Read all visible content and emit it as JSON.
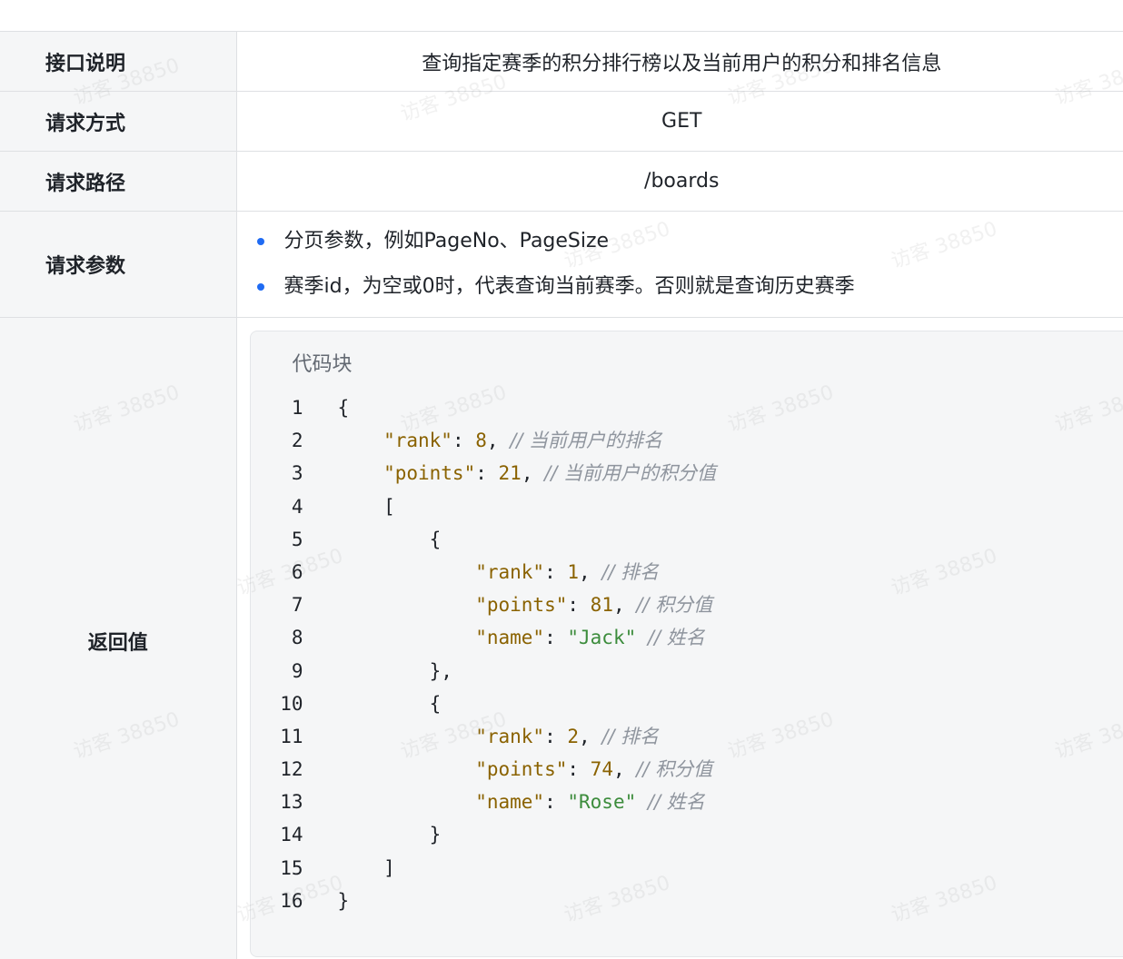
{
  "table": {
    "rows": [
      {
        "label": "接口说明",
        "value": "查询指定赛季的积分排行榜以及当前用户的积分和排名信息"
      },
      {
        "label": "请求方式",
        "value": "GET"
      },
      {
        "label": "请求路径",
        "value": "/boards"
      },
      {
        "label": "请求参数",
        "items": [
          "分页参数，例如PageNo、PageSize",
          "赛季id，为空或0时，代表查询当前赛季。否则就是查询历史赛季"
        ]
      },
      {
        "label": "返回值"
      }
    ]
  },
  "code": {
    "title": "代码块",
    "line_numbers": [
      "1",
      "2",
      "3",
      "4",
      "5",
      "6",
      "7",
      "8",
      "9",
      "10",
      "11",
      "12",
      "13",
      "14",
      "15",
      "16"
    ],
    "l1": "{",
    "l2_key": "\"rank\"",
    "l2_num": "8",
    "l2_comment": "// 当前用户的排名",
    "l3_key": "\"points\"",
    "l3_num": "21",
    "l3_comment": "// 当前用户的积分值",
    "l4": "[",
    "l5": "{",
    "l6_key": "\"rank\"",
    "l6_num": "1",
    "l6_comment": "// 排名",
    "l7_key": "\"points\"",
    "l7_num": "81",
    "l7_comment": "// 积分值",
    "l8_key": "\"name\"",
    "l8_str": "\"Jack\"",
    "l8_comment": "// 姓名",
    "l9": "},",
    "l10": "{",
    "l11_key": "\"rank\"",
    "l11_num": "2",
    "l11_comment": "// 排名",
    "l12_key": "\"points\"",
    "l12_num": "74",
    "l12_comment": "// 积分值",
    "l13_key": "\"name\"",
    "l13_str": "\"Rose\"",
    "l13_comment": "// 姓名",
    "l14": "}",
    "l15": "]",
    "l16": "}"
  },
  "watermark": "访客 38850"
}
